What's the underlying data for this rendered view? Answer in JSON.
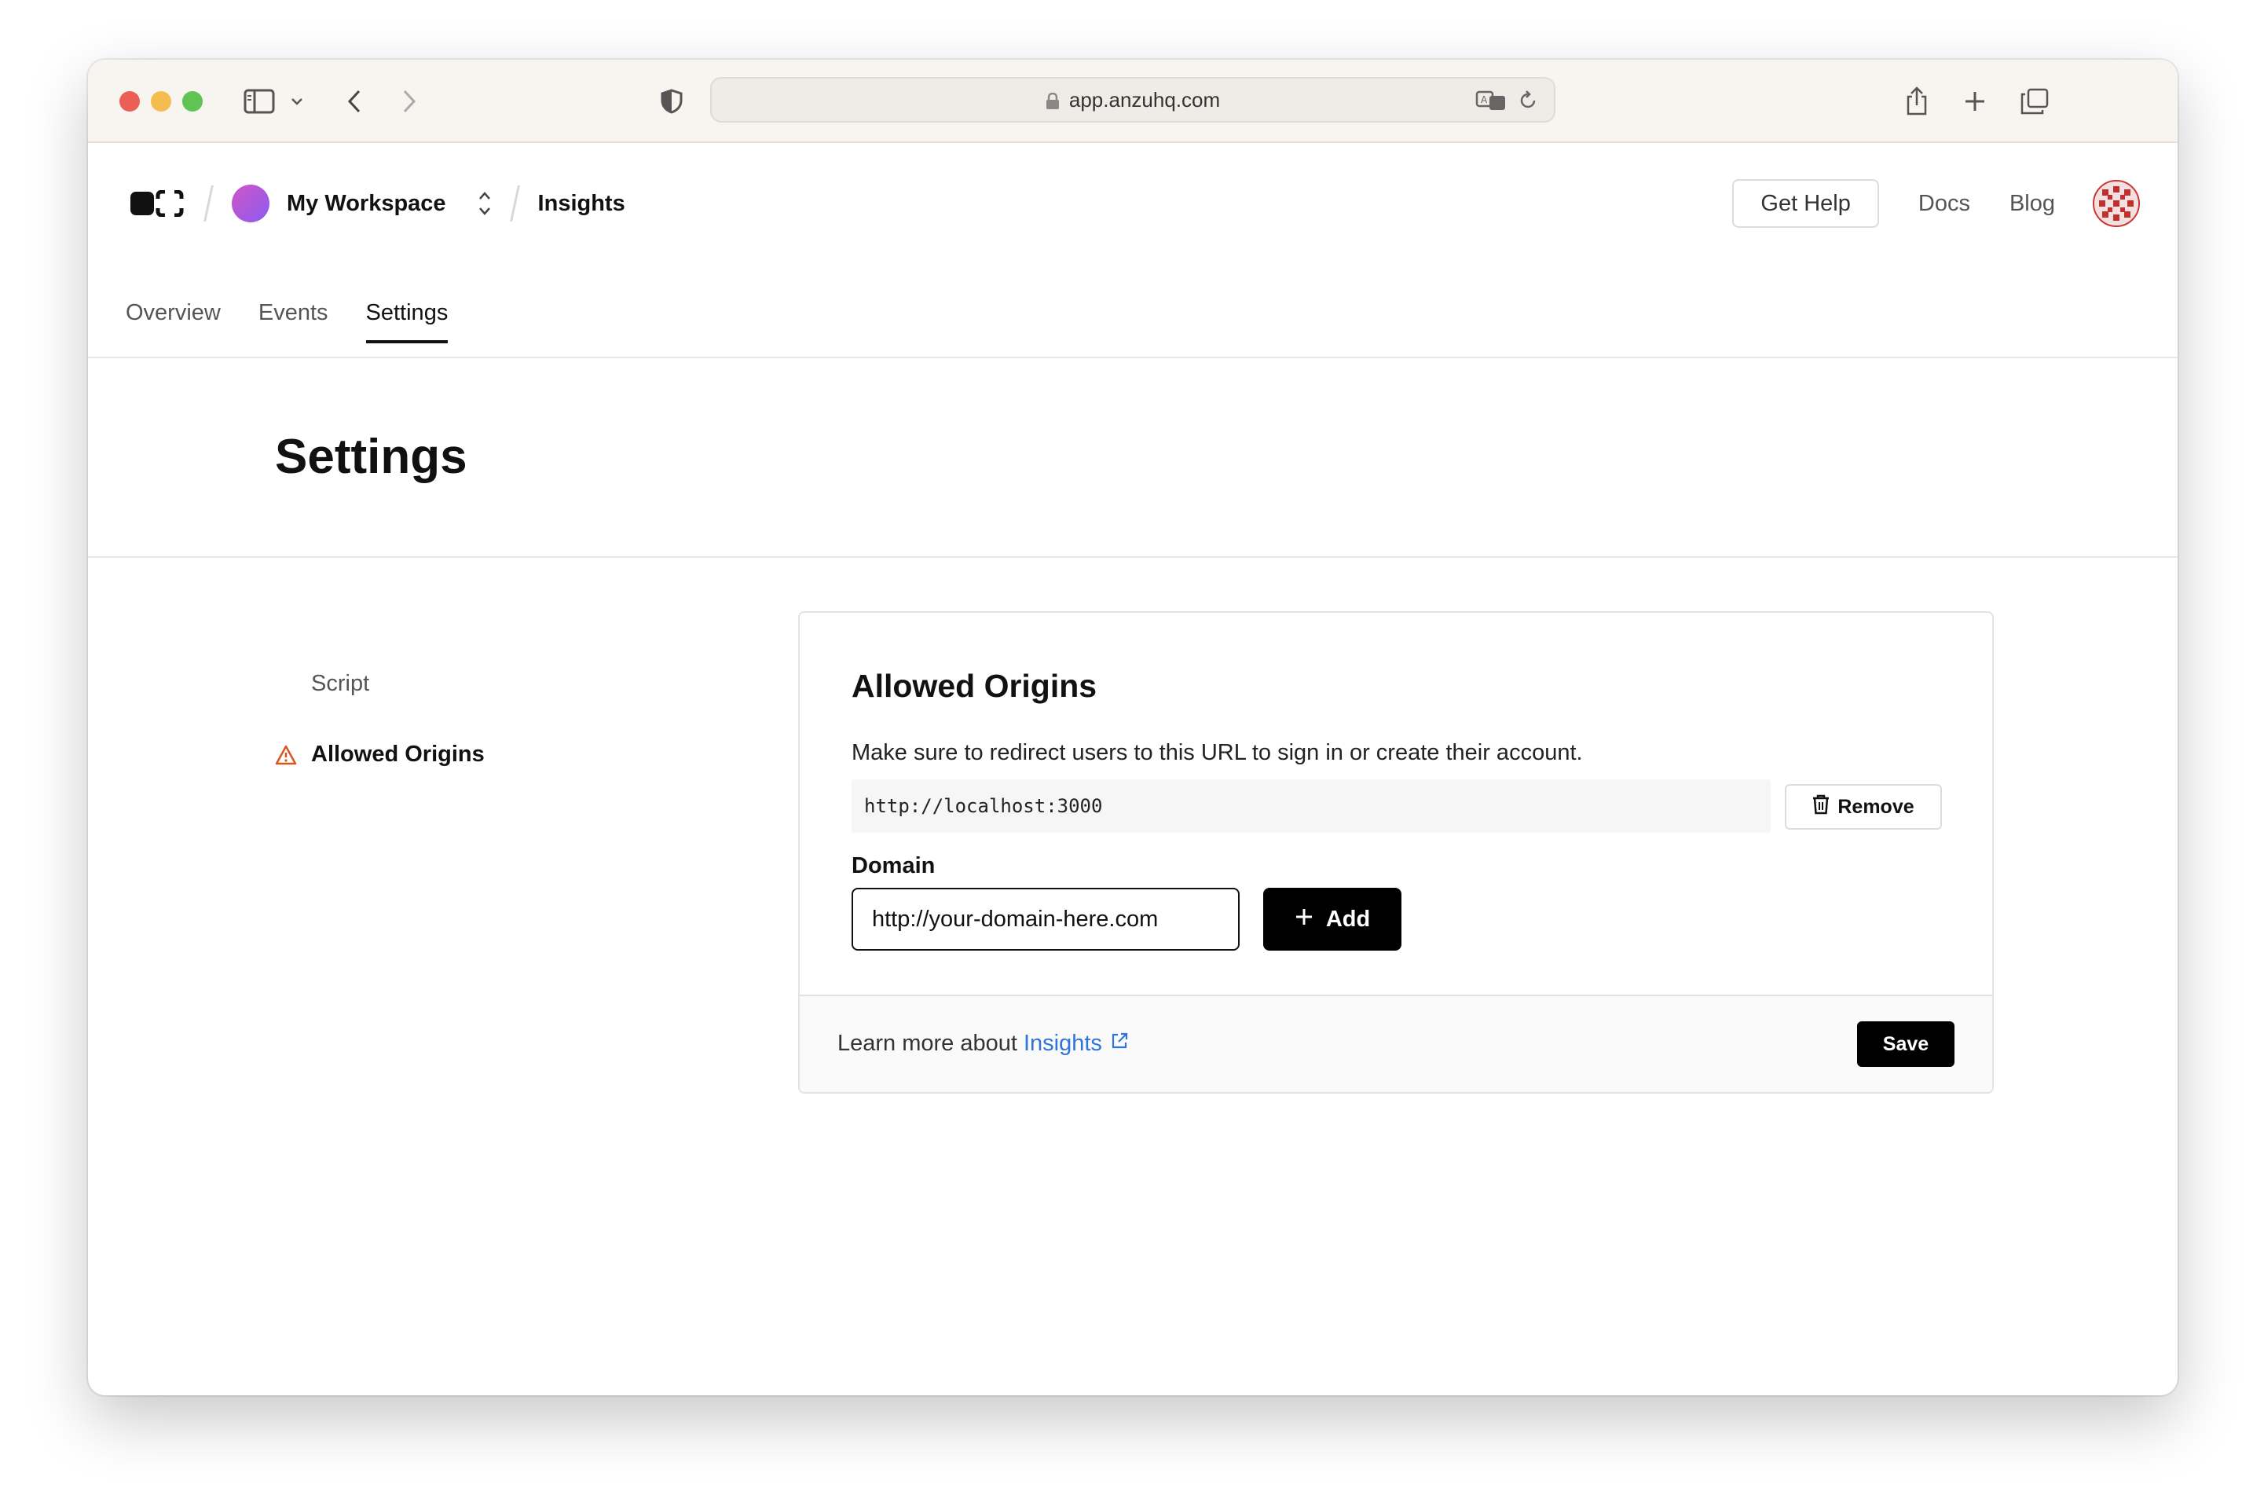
{
  "browser": {
    "url": "app.anzuhq.com",
    "icons": [
      "sidebar-icon",
      "chevron-down-icon",
      "back-icon",
      "forward-icon",
      "shield-icon",
      "lock-icon",
      "translate-icon",
      "reload-icon",
      "share-icon",
      "new-tab-icon",
      "tabs-overview-icon"
    ]
  },
  "header": {
    "workspace_name": "My Workspace",
    "project_name": "Insights",
    "help_label": "Get Help",
    "docs_label": "Docs",
    "blog_label": "Blog",
    "tabs": [
      {
        "label": "Overview",
        "active": false
      },
      {
        "label": "Events",
        "active": false
      },
      {
        "label": "Settings",
        "active": true
      }
    ]
  },
  "page": {
    "title": "Settings"
  },
  "side_nav": {
    "items": [
      {
        "label": "Script",
        "active": false
      },
      {
        "label": "Allowed Origins",
        "active": true,
        "icon": "warning-icon"
      }
    ]
  },
  "card": {
    "title": "Allowed Origins",
    "description": "Make sure to redirect users to this URL to sign in or create their account.",
    "origins": [
      "http://localhost:3000"
    ],
    "remove_label": "Remove",
    "domain_label": "Domain",
    "domain_value": "http://your-domain-here.com",
    "add_label": "Add",
    "footer_text": "Learn more about",
    "footer_link": "Insights",
    "save_label": "Save"
  },
  "colors": {
    "accent_link": "#2f74d8",
    "warning": "#d9541f",
    "primary_button": "#000000"
  }
}
